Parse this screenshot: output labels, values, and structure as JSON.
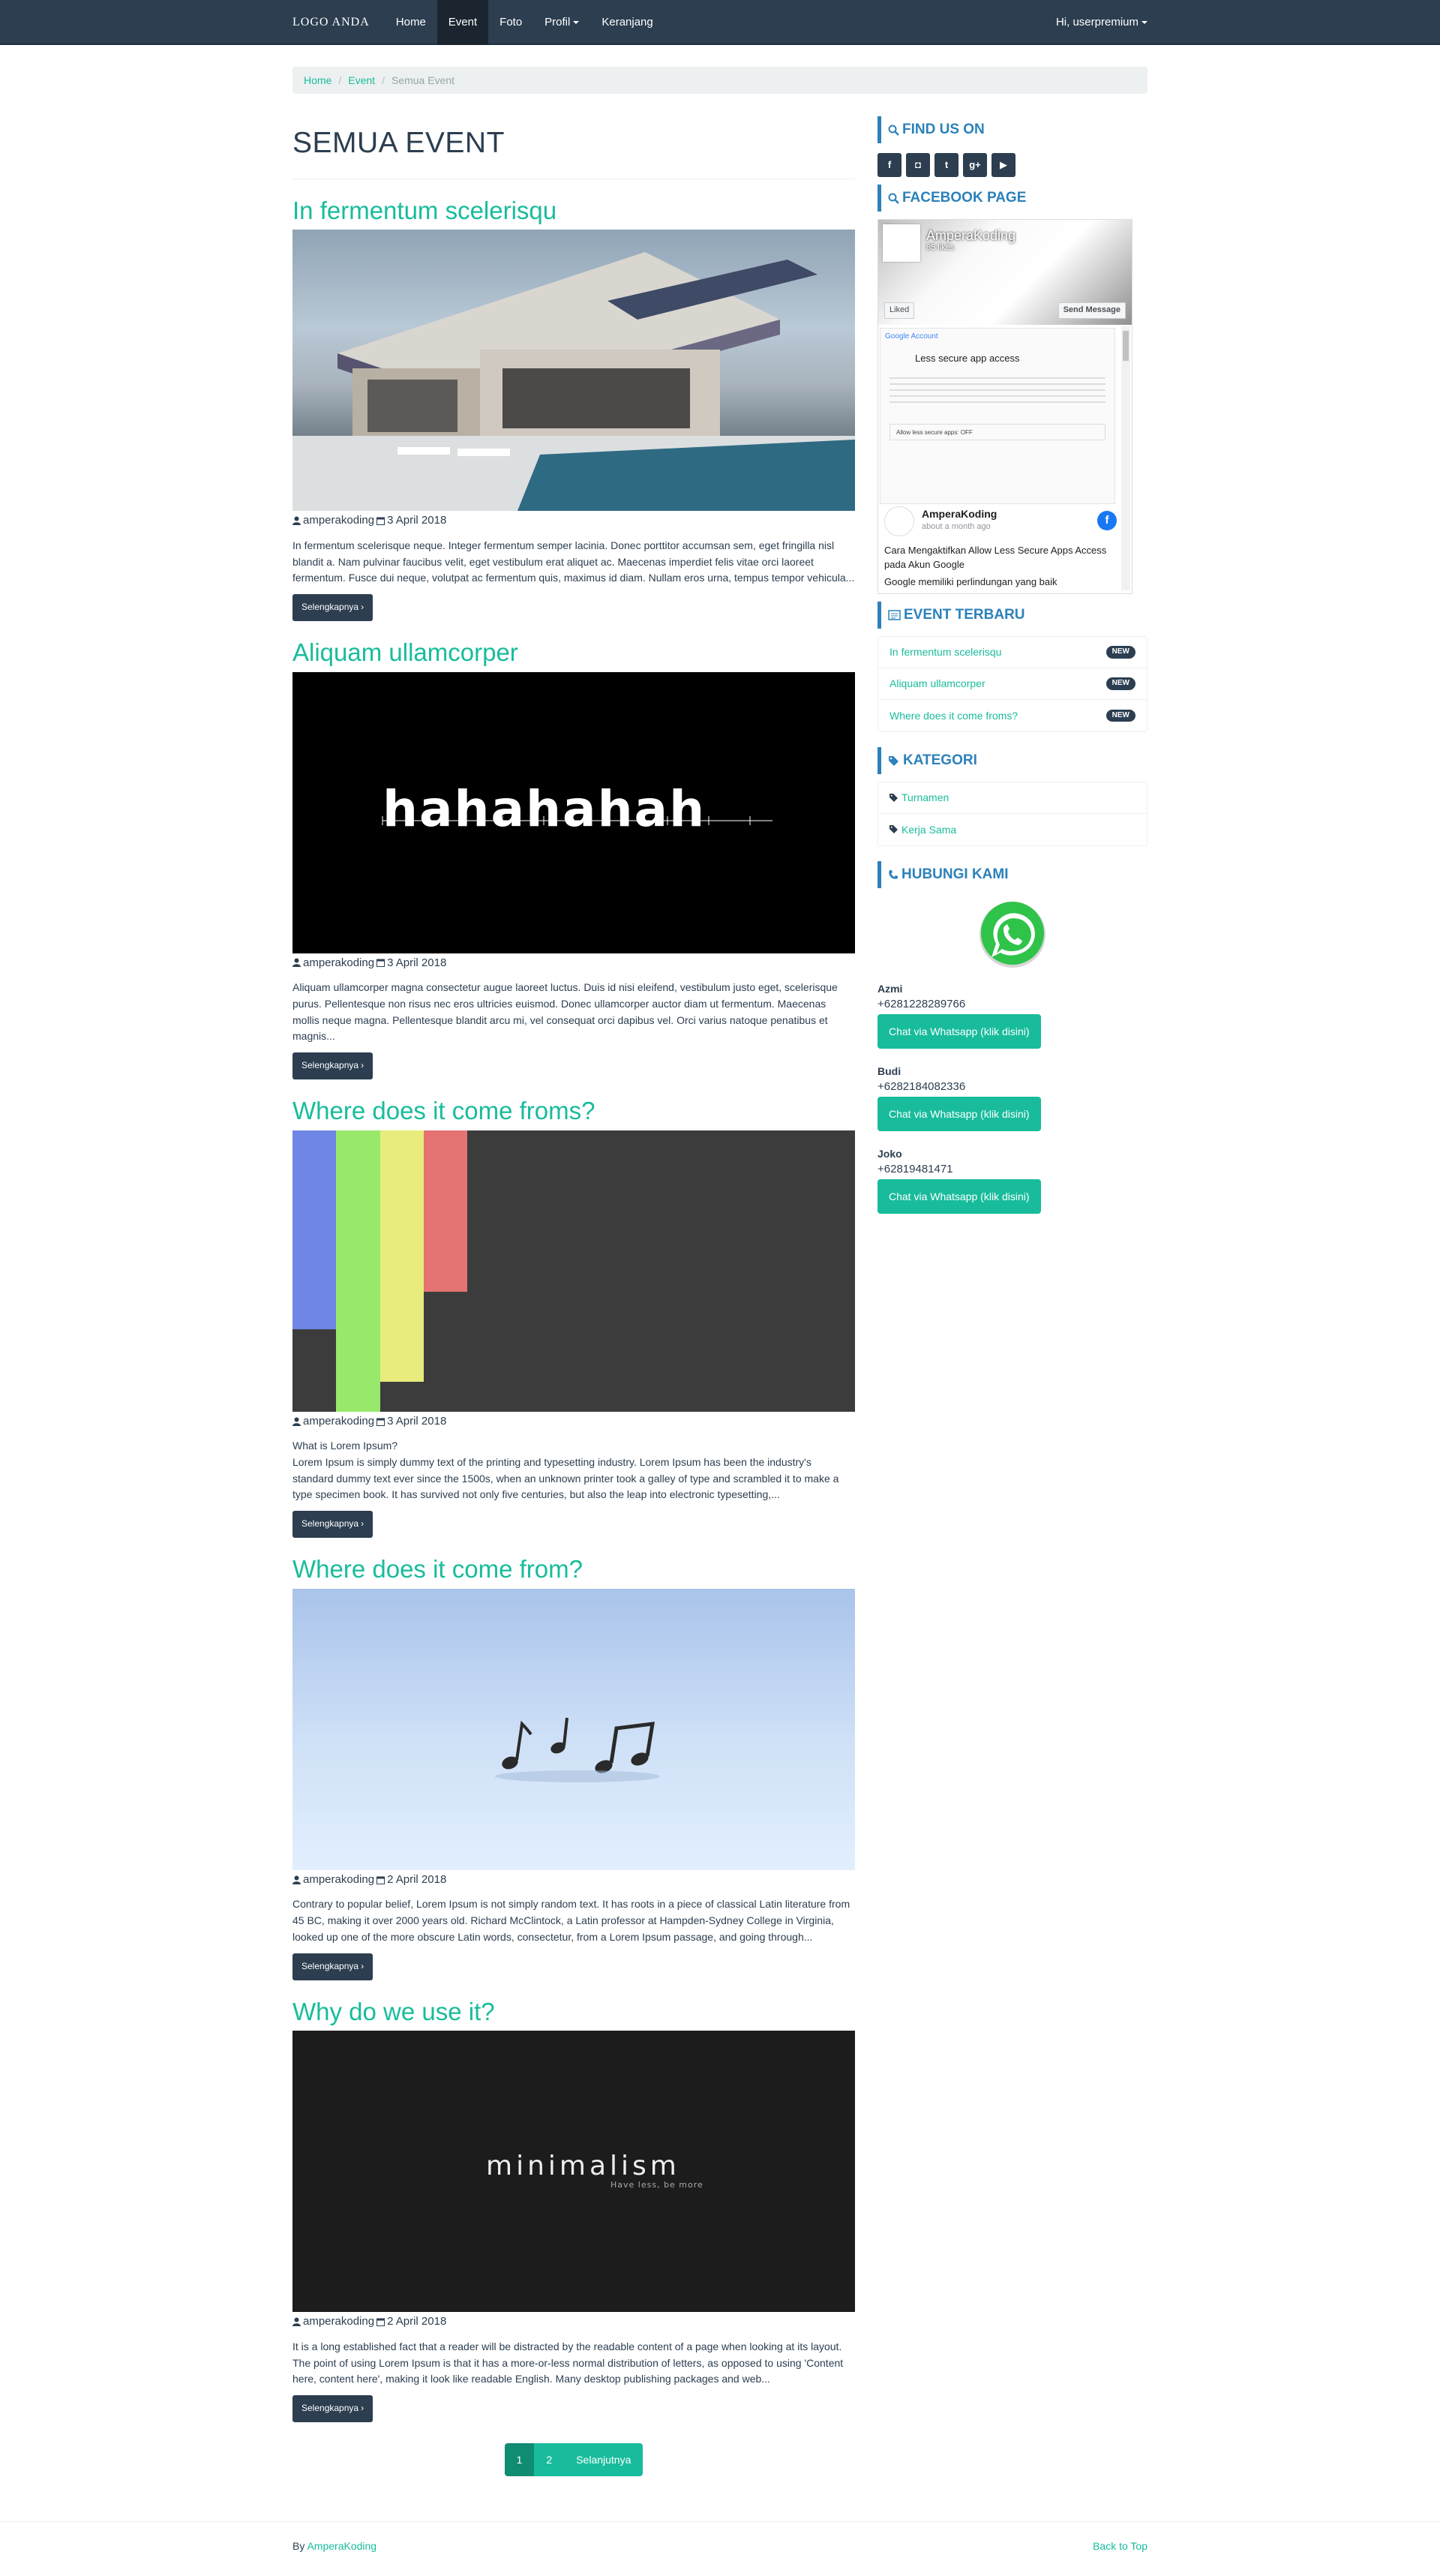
{
  "nav": {
    "brand": "Logo Anda",
    "items": [
      {
        "label": "Home"
      },
      {
        "label": "Event"
      },
      {
        "label": "Foto"
      },
      {
        "label": "Profil"
      },
      {
        "label": "Keranjang"
      }
    ],
    "user": "Hi, userpremium"
  },
  "breadcrumb": {
    "home": "Home",
    "event": "Event",
    "current": "Semua Event"
  },
  "page_title": "SEMUA EVENT",
  "posts": [
    {
      "title": "In fermentum scelerisqu",
      "author": "amperakoding",
      "date": "3 April 2018",
      "excerpt": "In fermentum scelerisque neque. Integer fermentum semper lacinia. Donec porttitor accumsan sem, eget fringilla nisl blandit a. Nam pulvinar faucibus velit, eget vestibulum erat aliquet ac. Maecenas imperdiet felis vitae orci laoreet fermentum. Fusce dui neque, volutpat ac fermentum quis, maximus id diam. Nullam eros urna, tempus tempor vehicula...",
      "button": "Selengkapnya"
    },
    {
      "title": "Aliquam ullamcorper",
      "author": "amperakoding",
      "date": "3 April 2018",
      "excerpt": "Aliquam ullamcorper magna consectetur augue laoreet luctus. Duis id nisi eleifend, vestibulum justo eget, scelerisque purus. Pellentesque non risus nec eros ultricies euismod. Donec ullamcorper auctor diam ut fermentum. Maecenas mollis neque magna. Pellentesque blandit arcu mi, vel consequat orci dapibus vel. Orci varius natoque penatibus et magnis...",
      "button": "Selengkapnya",
      "image_text": "hahahahah"
    },
    {
      "title": "Where does it come froms?",
      "author": "amperakoding",
      "date": "3 April 2018",
      "subhead": "What is Lorem Ipsum?",
      "excerpt": "Lorem Ipsum is simply dummy text of the printing and typesetting industry. Lorem Ipsum has been the industry's standard dummy text ever since the 1500s, when an unknown printer took a galley of type and scrambled it to make a type specimen book. It has survived not only five centuries, but also the leap into electronic typesetting,...",
      "button": "Selengkapnya"
    },
    {
      "title": "Where does it come from?",
      "author": "amperakoding",
      "date": "2 April 2018",
      "excerpt": "Contrary to popular belief, Lorem Ipsum is not simply random text. It has roots in a piece of classical Latin literature from 45 BC, making it over 2000 years old. Richard McClintock, a Latin professor at Hampden-Sydney College in Virginia, looked up one of the more obscure Latin words, consectetur, from a Lorem Ipsum passage, and going through...",
      "button": "Selengkapnya"
    },
    {
      "title": "Why do we use it?",
      "author": "amperakoding",
      "date": "2 April 2018",
      "excerpt": "It is a long established fact that a reader will be distracted by the readable content of a page when looking at its layout. The point of using Lorem Ipsum is that it has a more-or-less normal distribution of letters, as opposed to using 'Content here, content here', making it look like readable English. Many desktop publishing packages and web...",
      "button": "Selengkapnya",
      "image_text": "minimalism",
      "image_sub": "Have less, be more"
    }
  ],
  "pagination": {
    "page1": "1",
    "page2": "2",
    "next": "Selanjutnya"
  },
  "sidebar": {
    "find_us": "FIND US ON",
    "social_icons": [
      "facebook-icon",
      "instagram-icon",
      "twitter-icon",
      "google-plus-icon",
      "youtube-icon"
    ],
    "facebook_page": "FACEBOOK PAGE",
    "fb": {
      "page_name": "AmperaKoding",
      "likes": "85 likes",
      "liked": "Liked",
      "send": "Send Message",
      "shot_header": "Google Account",
      "shot_title": "Less secure app access",
      "shot_toggle": "Allow less secure apps: OFF",
      "post_name": "AmperaKoding",
      "post_time": "about a month ago",
      "post_text1": "Cara Mengaktifkan Allow Less Secure Apps Access pada Akun Google",
      "post_text2": "Google memiliki perlindungan yang baik"
    },
    "event_terbaru": "EVENT TERBARU",
    "events": [
      {
        "label": "In fermentum scelerisqu",
        "badge": "NEW"
      },
      {
        "label": "Aliquam ullamcorper",
        "badge": "NEW"
      },
      {
        "label": "Where does it come froms?",
        "badge": "NEW"
      }
    ],
    "kategori": "KATEGORI",
    "categories": [
      {
        "label": "Turnamen"
      },
      {
        "label": "Kerja Sama"
      }
    ],
    "hubungi": "HUBUNGI KAMI",
    "contacts": [
      {
        "name": "Azmi",
        "phone": "+6281228289766",
        "button": "Chat via Whatsapp (klik disini)"
      },
      {
        "name": "Budi",
        "phone": "+6282184082336",
        "button": "Chat via Whatsapp (klik disini)"
      },
      {
        "name": "Joko",
        "phone": "+62819481471",
        "button": "Chat via Whatsapp (klik disini)"
      }
    ]
  },
  "footer": {
    "by": "By",
    "author_link": "AmperaKoding",
    "back_to_top": "Back to Top"
  },
  "colors": {
    "navbar": "#2c3e50",
    "accent": "#18bc9c",
    "sidebar_accent": "#2c81ba"
  }
}
